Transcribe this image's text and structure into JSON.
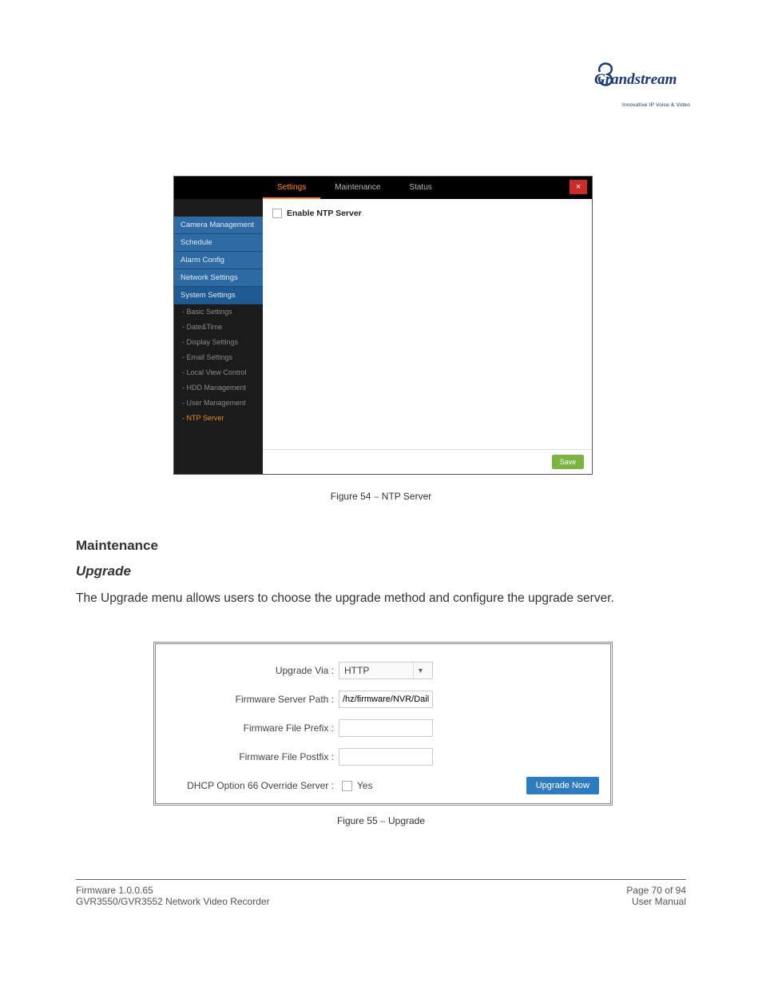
{
  "logo": {
    "brand": "Grandstream",
    "tagline": "Innovative IP Voice & Video"
  },
  "figure1": {
    "tabs": {
      "settings": "Settings",
      "maintenance": "Maintenance",
      "status": "Status"
    },
    "close": "×",
    "sidebar": {
      "items": [
        "Camera Management",
        "Schedule",
        "Alarm Config",
        "Network Settings",
        "System Settings"
      ],
      "subitems": [
        "Basic Settings",
        "Date&Time",
        "Display Settings",
        "Email Settings",
        "Local View Control",
        "HDD Management",
        "User Management",
        "NTP Server"
      ]
    },
    "checkbox_label": "Enable NTP Server",
    "save": "Save",
    "caption_prefix": "Figure 54 ",
    "caption_sep": "– ",
    "caption_text": "NTP Server"
  },
  "midtext": {
    "heading": "Maintenance",
    "sub": "Upgrade",
    "body": "The Upgrade menu allows users to choose the upgrade method and configure the upgrade server."
  },
  "figure2": {
    "labels": {
      "upgrade_via": "Upgrade Via :",
      "server_path": "Firmware Server Path :",
      "file_prefix": "Firmware File Prefix :",
      "file_postfix": "Firmware File Postfix :",
      "dhcp66": "DHCP Option 66 Override Server :"
    },
    "values": {
      "upgrade_via": "HTTP",
      "server_path": "/hz/firmware/NVR/DailyBuild/",
      "file_prefix": "",
      "file_postfix": "",
      "dhcp66_text": "Yes"
    },
    "button": "Upgrade Now",
    "caption_prefix": "Figure 55 ",
    "caption_sep": "– ",
    "caption_text": "Upgrade"
  },
  "footer": {
    "left_line1": "Firmware 1.0.0.65",
    "left_line2": "GVR3550/GVR3552 Network Video Recorder",
    "right_line1": "Page 70 of 94",
    "right_line2": "User Manual"
  }
}
